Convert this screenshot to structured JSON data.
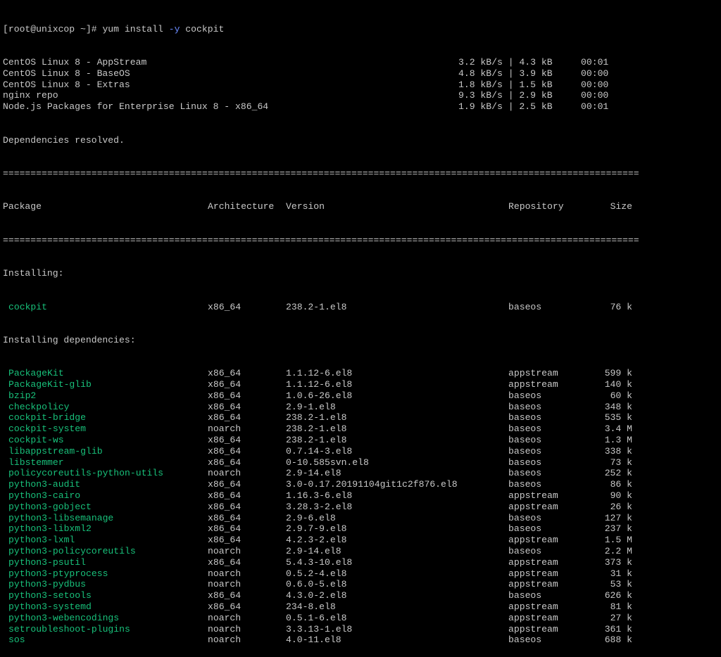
{
  "prompt": "[root@unixcop ~]# ",
  "command_base": "yum install ",
  "command_flag": "-y",
  "command_arg": " cockpit",
  "repos": [
    {
      "name": "CentOS Linux 8 - AppStream",
      "speed": "3.2 kB/s | 4.3 kB",
      "time": "00:01"
    },
    {
      "name": "CentOS Linux 8 - BaseOS",
      "speed": "4.8 kB/s | 3.9 kB",
      "time": "00:00"
    },
    {
      "name": "CentOS Linux 8 - Extras",
      "speed": "1.8 kB/s | 1.5 kB",
      "time": "00:00"
    },
    {
      "name": "nginx repo",
      "speed": "9.3 kB/s | 2.9 kB",
      "time": "00:00"
    },
    {
      "name": "Node.js Packages for Enterprise Linux 8 - x86_64",
      "speed": "1.9 kB/s | 2.5 kB",
      "time": "00:01"
    }
  ],
  "deps_resolved": "Dependencies resolved.",
  "separator": "===================================================================================================================",
  "headers": {
    "package": "Package",
    "arch": "Architecture",
    "version": "Version",
    "repo": "Repository",
    "size": "Size"
  },
  "section_installing": "Installing:",
  "section_deps": "Installing dependencies:",
  "install_pkgs": [
    {
      "name": "cockpit",
      "arch": "x86_64",
      "version": "238.2-1.el8",
      "repo": "baseos",
      "size": "76 k"
    }
  ],
  "dep_pkgs": [
    {
      "name": "PackageKit",
      "arch": "x86_64",
      "version": "1.1.12-6.el8",
      "repo": "appstream",
      "size": "599 k"
    },
    {
      "name": "PackageKit-glib",
      "arch": "x86_64",
      "version": "1.1.12-6.el8",
      "repo": "appstream",
      "size": "140 k"
    },
    {
      "name": "bzip2",
      "arch": "x86_64",
      "version": "1.0.6-26.el8",
      "repo": "baseos",
      "size": "60 k"
    },
    {
      "name": "checkpolicy",
      "arch": "x86_64",
      "version": "2.9-1.el8",
      "repo": "baseos",
      "size": "348 k"
    },
    {
      "name": "cockpit-bridge",
      "arch": "x86_64",
      "version": "238.2-1.el8",
      "repo": "baseos",
      "size": "535 k"
    },
    {
      "name": "cockpit-system",
      "arch": "noarch",
      "version": "238.2-1.el8",
      "repo": "baseos",
      "size": "3.4 M"
    },
    {
      "name": "cockpit-ws",
      "arch": "x86_64",
      "version": "238.2-1.el8",
      "repo": "baseos",
      "size": "1.3 M"
    },
    {
      "name": "libappstream-glib",
      "arch": "x86_64",
      "version": "0.7.14-3.el8",
      "repo": "baseos",
      "size": "338 k"
    },
    {
      "name": "libstemmer",
      "arch": "x86_64",
      "version": "0-10.585svn.el8",
      "repo": "baseos",
      "size": "73 k"
    },
    {
      "name": "policycoreutils-python-utils",
      "arch": "noarch",
      "version": "2.9-14.el8",
      "repo": "baseos",
      "size": "252 k"
    },
    {
      "name": "python3-audit",
      "arch": "x86_64",
      "version": "3.0-0.17.20191104git1c2f876.el8",
      "repo": "baseos",
      "size": "86 k"
    },
    {
      "name": "python3-cairo",
      "arch": "x86_64",
      "version": "1.16.3-6.el8",
      "repo": "appstream",
      "size": "90 k"
    },
    {
      "name": "python3-gobject",
      "arch": "x86_64",
      "version": "3.28.3-2.el8",
      "repo": "appstream",
      "size": "26 k"
    },
    {
      "name": "python3-libsemanage",
      "arch": "x86_64",
      "version": "2.9-6.el8",
      "repo": "baseos",
      "size": "127 k"
    },
    {
      "name": "python3-libxml2",
      "arch": "x86_64",
      "version": "2.9.7-9.el8",
      "repo": "baseos",
      "size": "237 k"
    },
    {
      "name": "python3-lxml",
      "arch": "x86_64",
      "version": "4.2.3-2.el8",
      "repo": "appstream",
      "size": "1.5 M"
    },
    {
      "name": "python3-policycoreutils",
      "arch": "noarch",
      "version": "2.9-14.el8",
      "repo": "baseos",
      "size": "2.2 M"
    },
    {
      "name": "python3-psutil",
      "arch": "x86_64",
      "version": "5.4.3-10.el8",
      "repo": "appstream",
      "size": "373 k"
    },
    {
      "name": "python3-ptyprocess",
      "arch": "noarch",
      "version": "0.5.2-4.el8",
      "repo": "appstream",
      "size": "31 k"
    },
    {
      "name": "python3-pydbus",
      "arch": "noarch",
      "version": "0.6.0-5.el8",
      "repo": "appstream",
      "size": "53 k"
    },
    {
      "name": "python3-setools",
      "arch": "x86_64",
      "version": "4.3.0-2.el8",
      "repo": "baseos",
      "size": "626 k"
    },
    {
      "name": "python3-systemd",
      "arch": "x86_64",
      "version": "234-8.el8",
      "repo": "appstream",
      "size": "81 k"
    },
    {
      "name": "python3-webencodings",
      "arch": "noarch",
      "version": "0.5.1-6.el8",
      "repo": "appstream",
      "size": "27 k"
    },
    {
      "name": "setroubleshoot-plugins",
      "arch": "noarch",
      "version": "3.3.13-1.el8",
      "repo": "appstream",
      "size": "361 k"
    },
    {
      "name": "sos",
      "arch": "noarch",
      "version": "4.0-11.el8",
      "repo": "baseos",
      "size": "688 k"
    }
  ]
}
